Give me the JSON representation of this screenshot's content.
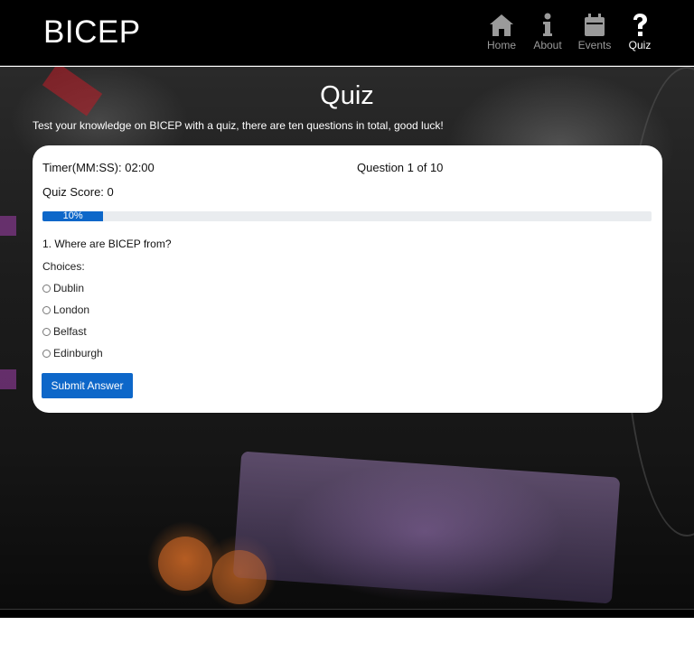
{
  "brand": "BICEP",
  "nav": [
    {
      "label": "Home",
      "icon": "home-icon"
    },
    {
      "label": "About",
      "icon": "info-icon"
    },
    {
      "label": "Events",
      "icon": "calendar-icon"
    },
    {
      "label": "Quiz",
      "icon": "question-icon",
      "active": true
    }
  ],
  "hero": {
    "title": "Quiz",
    "intro": "Test your knowledge on BICEP with a quiz, there are ten questions in total, good luck!"
  },
  "quiz": {
    "timer_label": "Timer(MM:SS): 02:00",
    "question_count": "Question 1 of 10",
    "score_label": "Quiz Score: 0",
    "progress_percent": 10,
    "progress_label": "10%",
    "question": "1. Where are BICEP from?",
    "choices_label": "Choices:",
    "choices": [
      "Dublin",
      "London",
      "Belfast",
      "Edinburgh"
    ],
    "submit_label": "Submit Answer"
  },
  "colors": {
    "accent": "#0d67c9",
    "header_bg": "#000000",
    "nav_inactive": "#9a9a9a",
    "nav_active": "#ffffff"
  }
}
